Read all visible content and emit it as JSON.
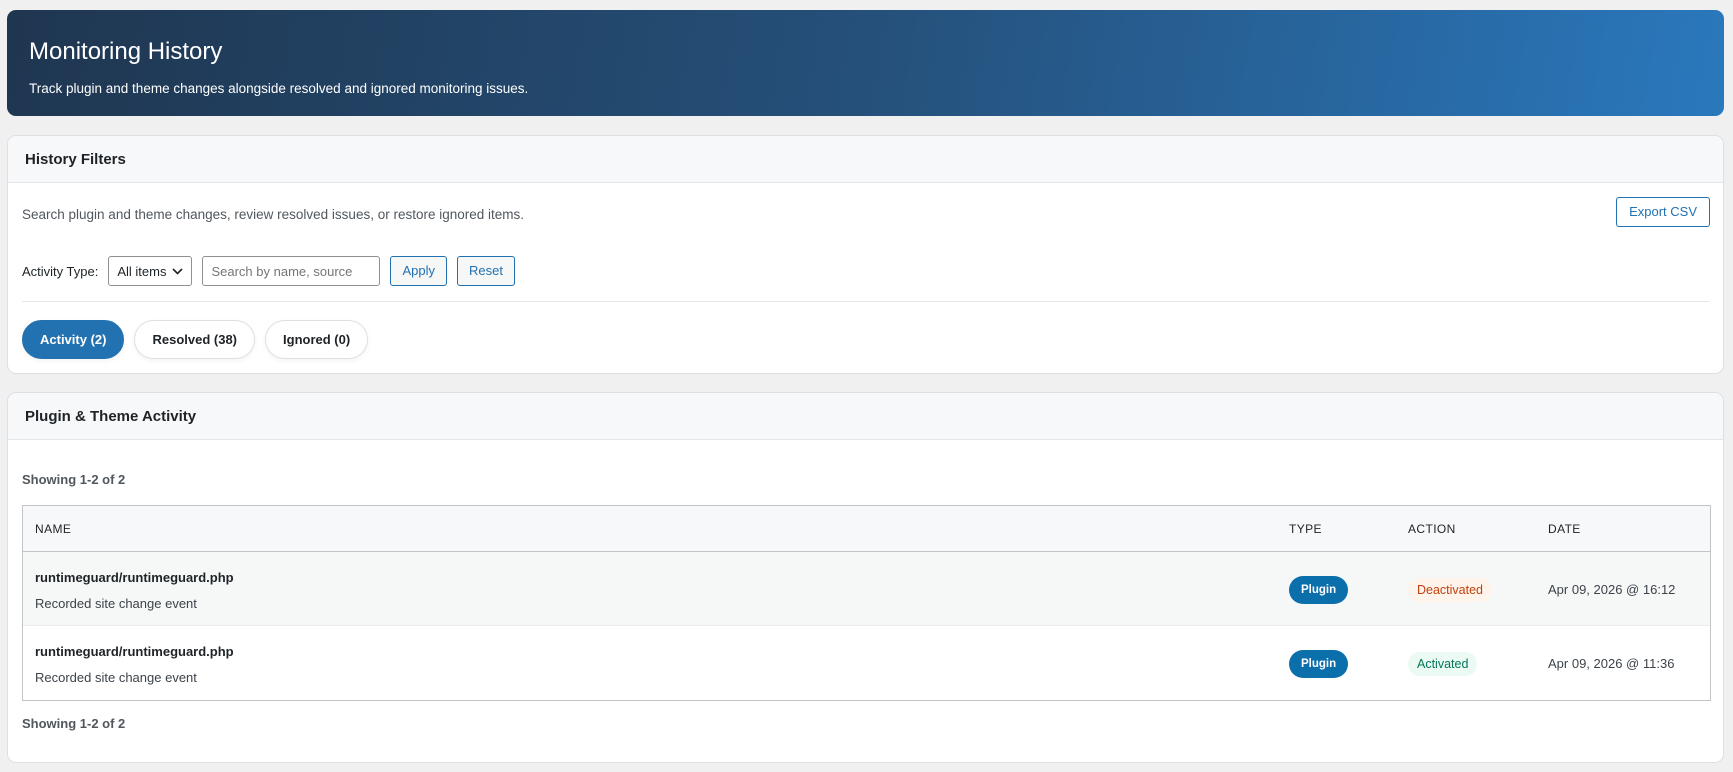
{
  "header": {
    "title": "Monitoring History",
    "subtitle": "Track plugin and theme changes alongside resolved and ignored monitoring issues."
  },
  "filters": {
    "title": "History Filters",
    "description": "Search plugin and theme changes, review resolved issues, or restore ignored items.",
    "export_label": "Export CSV",
    "activity_type_label": "Activity Type:",
    "activity_type_value": "All items",
    "search_placeholder": "Search by name, source",
    "apply_label": "Apply",
    "reset_label": "Reset",
    "tabs": [
      {
        "label": "Activity (2)",
        "active": true
      },
      {
        "label": "Resolved (38)"
      },
      {
        "label": "Ignored (0)"
      }
    ]
  },
  "activity": {
    "title": "Plugin & Theme Activity",
    "showing": "Showing 1-2 of 2",
    "columns": [
      "NAME",
      "TYPE",
      "ACTION",
      "DATE"
    ],
    "rows": [
      {
        "name": "runtimeguard/runtimeguard.php",
        "sub": "Recorded site change event",
        "type": "Plugin",
        "action": "Deactivated",
        "date": "Apr 09, 2026 @ 16:12"
      },
      {
        "name": "runtimeguard/runtimeguard.php",
        "sub": "Recorded site change event",
        "type": "Plugin",
        "action": "Activated",
        "date": "Apr 09, 2026 @ 11:36"
      }
    ]
  },
  "colors": {
    "accent": "#2271b1",
    "plugin_badge": "#0a6fab",
    "deactivated": "#c2410c",
    "activated": "#047857"
  }
}
